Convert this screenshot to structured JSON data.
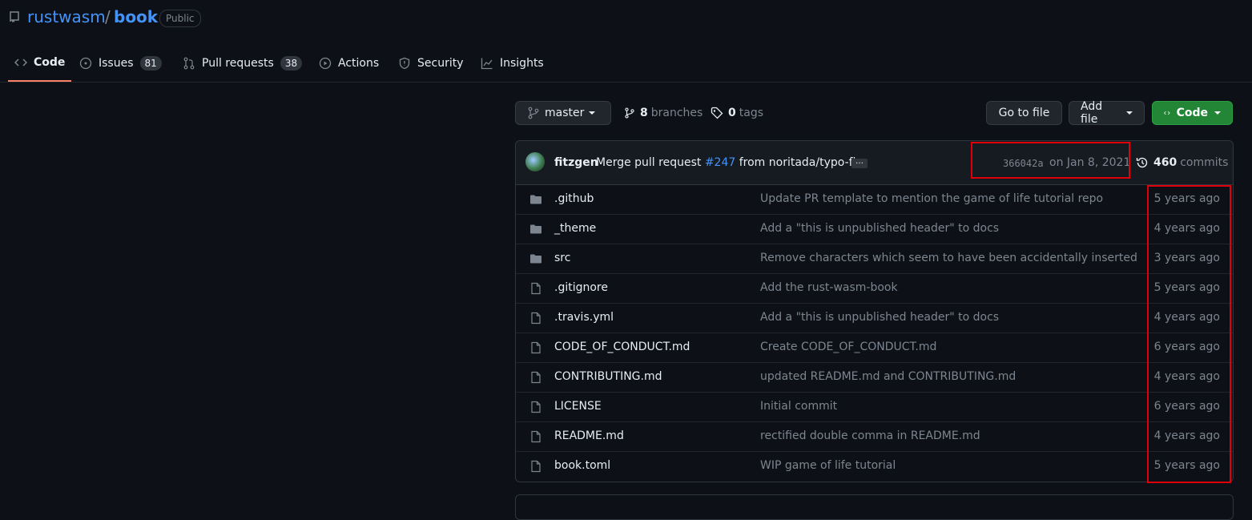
{
  "repo": {
    "owner": "rustwasm",
    "separator": "/",
    "name": "book",
    "visibility": "Public"
  },
  "nav": {
    "tabs": [
      {
        "label": "Code",
        "icon": "code-icon",
        "active": true
      },
      {
        "label": "Issues",
        "icon": "issue-icon",
        "count": "81"
      },
      {
        "label": "Pull requests",
        "icon": "pull-request-icon",
        "count": "38"
      },
      {
        "label": "Actions",
        "icon": "play-icon"
      },
      {
        "label": "Security",
        "icon": "shield-icon"
      },
      {
        "label": "Insights",
        "icon": "graph-icon"
      }
    ]
  },
  "toolbar": {
    "branch": "master",
    "branches_count": "8",
    "branches_label": "branches",
    "tags_count": "0",
    "tags_label": "tags",
    "go_to_file": "Go to file",
    "add_file": "Add file",
    "code_button": "Code"
  },
  "latest_commit": {
    "author": "fitzgen",
    "message_prefix": "Merge pull request",
    "pr_number": "#247",
    "message_suffix": "from noritada/typo-fix",
    "ellipsis": "…",
    "sha": "366042a",
    "date": "on Jan 8, 2021",
    "commits_count": "460",
    "commits_label": "commits"
  },
  "files": [
    {
      "name": ".github",
      "type": "dir",
      "message": "Update PR template to mention the game of life tutorial repo",
      "age": "5 years ago"
    },
    {
      "name": "_theme",
      "type": "dir",
      "message": "Add a \"this is unpublished header\" to docs",
      "age": "4 years ago"
    },
    {
      "name": "src",
      "type": "dir",
      "message": "Remove characters which seem to have been accidentally inserted",
      "age": "3 years ago"
    },
    {
      "name": ".gitignore",
      "type": "file",
      "message": "Add the rust-wasm-book",
      "age": "5 years ago"
    },
    {
      "name": ".travis.yml",
      "type": "file",
      "message": "Add a \"this is unpublished header\" to docs",
      "age": "4 years ago"
    },
    {
      "name": "CODE_OF_CONDUCT.md",
      "type": "file",
      "message": "Create CODE_OF_CONDUCT.md",
      "age": "6 years ago"
    },
    {
      "name": "CONTRIBUTING.md",
      "type": "file",
      "message": "updated README.md and CONTRIBUTING.md",
      "age": "4 years ago"
    },
    {
      "name": "LICENSE",
      "type": "file",
      "message": "Initial commit",
      "age": "6 years ago"
    },
    {
      "name": "README.md",
      "type": "file",
      "message": "rectified double comma in README.md",
      "age": "4 years ago"
    },
    {
      "name": "book.toml",
      "type": "file",
      "message": "WIP game of life tutorial",
      "age": "5 years ago"
    }
  ],
  "colors": {
    "background": "#0d1117",
    "link": "#4493f8",
    "muted": "#7d8590",
    "active_tab_underline": "#f78166",
    "primary_button": "#238636",
    "highlight_box": "#e0000a"
  }
}
